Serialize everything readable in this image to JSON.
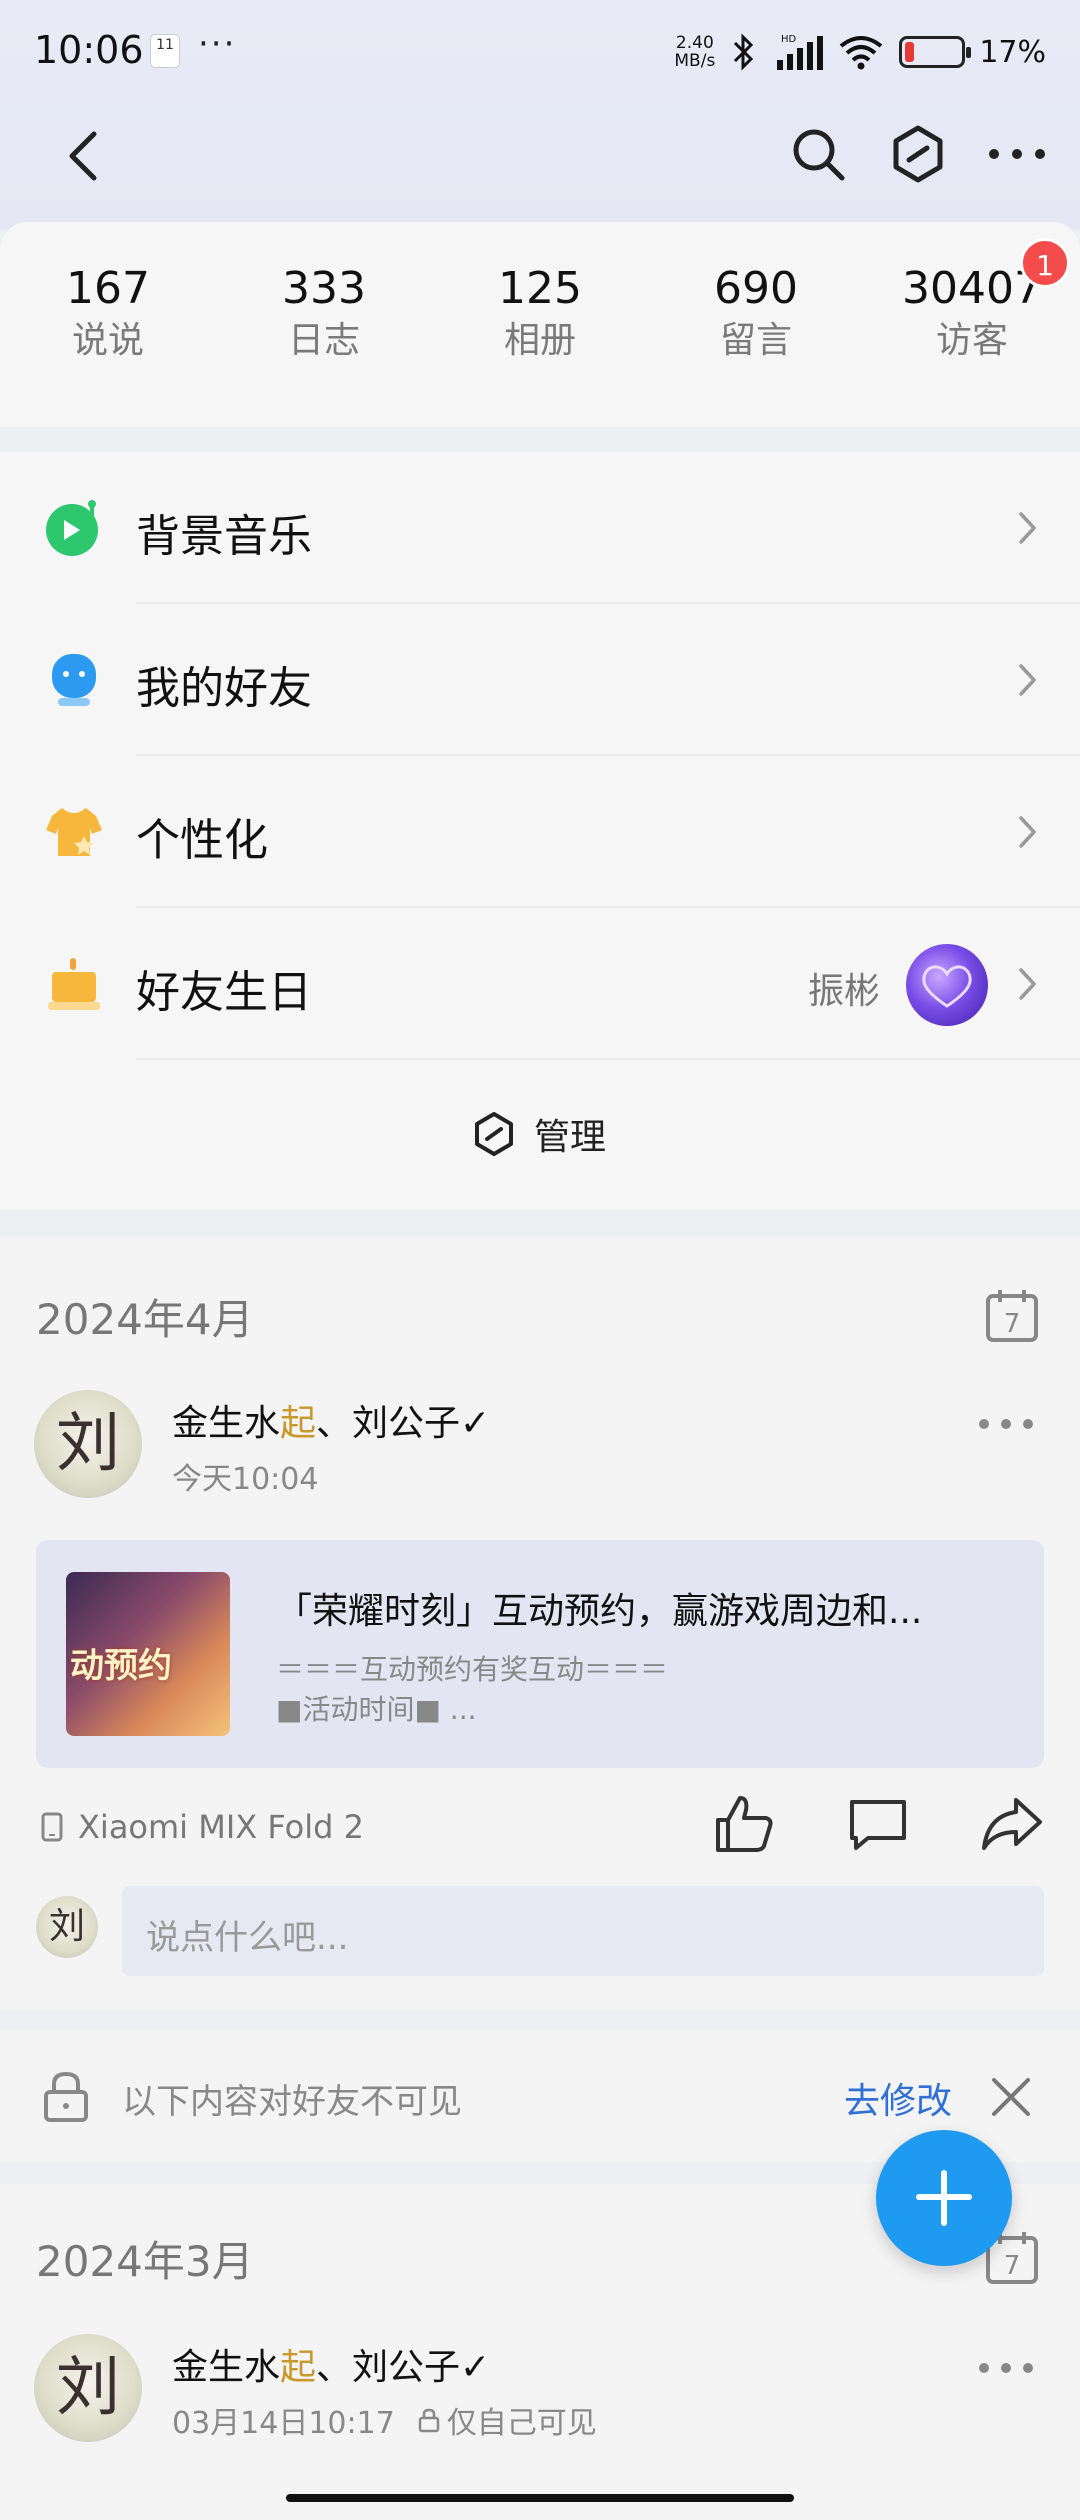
{
  "status_bar": {
    "time": "10:06",
    "calendar_day": "11",
    "notif_dots": "···",
    "net_speed_value": "2.40",
    "net_speed_unit": "MB/s",
    "battery_percent_text": "17%",
    "battery_level": 0.17,
    "battery_color": "#e53935"
  },
  "stats": [
    {
      "num": "167",
      "label": "说说"
    },
    {
      "num": "333",
      "label": "日志"
    },
    {
      "num": "125",
      "label": "相册"
    },
    {
      "num": "690",
      "label": "留言"
    },
    {
      "num": "30407",
      "label": "访客"
    }
  ],
  "visitor_badge": "1",
  "menu": {
    "items": [
      {
        "label": "背景音乐",
        "icon": "music-icon"
      },
      {
        "label": "我的好友",
        "icon": "friend-icon"
      },
      {
        "label": "个性化",
        "icon": "shirt-icon"
      },
      {
        "label": "好友生日",
        "icon": "cake-icon"
      }
    ],
    "birthday_friend": "振彬",
    "manage_label": "管理"
  },
  "feed1": {
    "month": "2024年4月",
    "calendar_icon_day": "7",
    "author_part1": "金生水",
    "author_highlight": "起",
    "author_part2": "、刘公子✓",
    "time": "今天10:04",
    "avatar_glyph": "刘",
    "share": {
      "title": "「荣耀时刻」互动预约，赢游戏周边和...",
      "line1": "＝＝＝互动预约有奖互动＝＝＝",
      "line2": "■活动时间■ ...",
      "thumb_text": "动预约"
    },
    "device": "Xiaomi MIX Fold 2",
    "comment_placeholder": "说点什么吧..."
  },
  "privacy": {
    "text": "以下内容对好友不可见",
    "edit": "去修改"
  },
  "feed2": {
    "month": "2024年3月",
    "calendar_icon_day": "7",
    "author_part1": "金生水",
    "author_highlight": "起",
    "author_part2": "、刘公子✓",
    "time": "03月14日10:17",
    "visibility": "仅自己可见",
    "avatar_glyph": "刘"
  },
  "colors": {
    "accent_blue": "#1e9bf0",
    "link_blue": "#2f6fd6",
    "badge_red": "#f44b4b",
    "music_green": "#2dc76d",
    "friend_blue": "#2c9af0",
    "warm_orange": "#f6b73c"
  }
}
